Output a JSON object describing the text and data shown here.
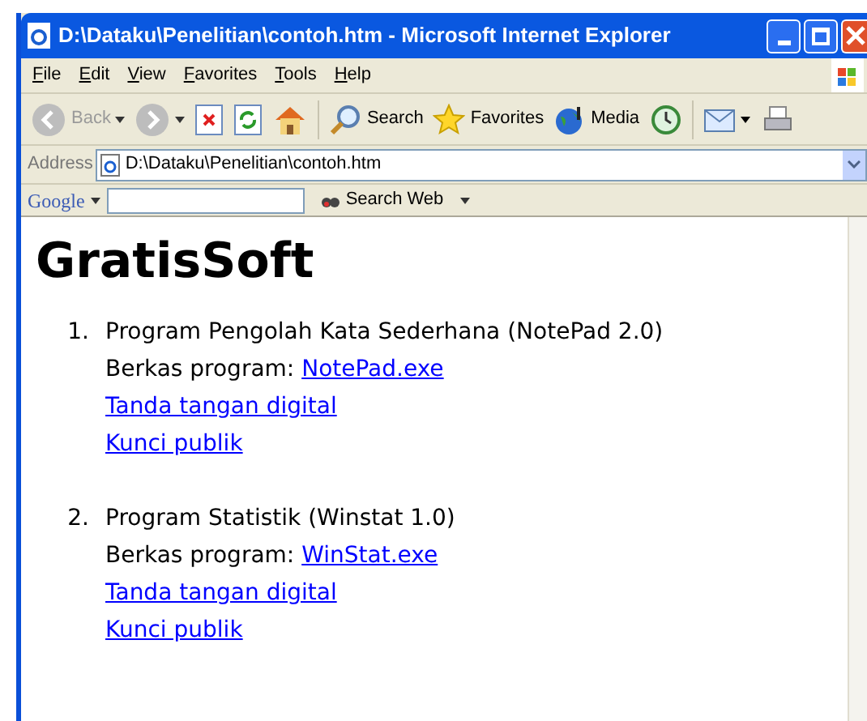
{
  "window": {
    "title": "D:\\Dataku\\Penelitian\\contoh.htm - Microsoft Internet Explorer"
  },
  "menu": [
    "File",
    "Edit",
    "View",
    "Favorites",
    "Tools",
    "Help"
  ],
  "toolbar": [
    {
      "kind": "back",
      "label": "Back",
      "disabled": true
    },
    {
      "kind": "forward",
      "disabled": true
    },
    {
      "kind": "stop"
    },
    {
      "kind": "refresh"
    },
    {
      "kind": "home"
    },
    {
      "kind": "sep"
    },
    {
      "kind": "search",
      "label": "Search"
    },
    {
      "kind": "favorites",
      "label": "Favorites"
    },
    {
      "kind": "media",
      "label": "Media"
    },
    {
      "kind": "history"
    },
    {
      "kind": "sep"
    },
    {
      "kind": "mail"
    },
    {
      "kind": "print"
    }
  ],
  "address": {
    "label": "Address",
    "value": "D:\\Dataku\\Penelitian\\contoh.htm"
  },
  "google_bar": {
    "logo": "Google",
    "search_label": "Search Web"
  },
  "page": {
    "heading": "GratisSoft",
    "items": [
      {
        "number": "1.",
        "title": "Program Pengolah Kata Sederhana (NotePad 2.0)",
        "file_label": "Berkas program: ",
        "file_link": "NotePad.exe",
        "links": [
          "Tanda tangan digital",
          "Kunci publik"
        ]
      },
      {
        "number": "2.",
        "title": "Program Statistik (Winstat 1.0)",
        "file_label": "Berkas program: ",
        "file_link": "WinStat.exe",
        "links": [
          "Tanda tangan digital",
          "Kunci publik"
        ]
      }
    ]
  }
}
